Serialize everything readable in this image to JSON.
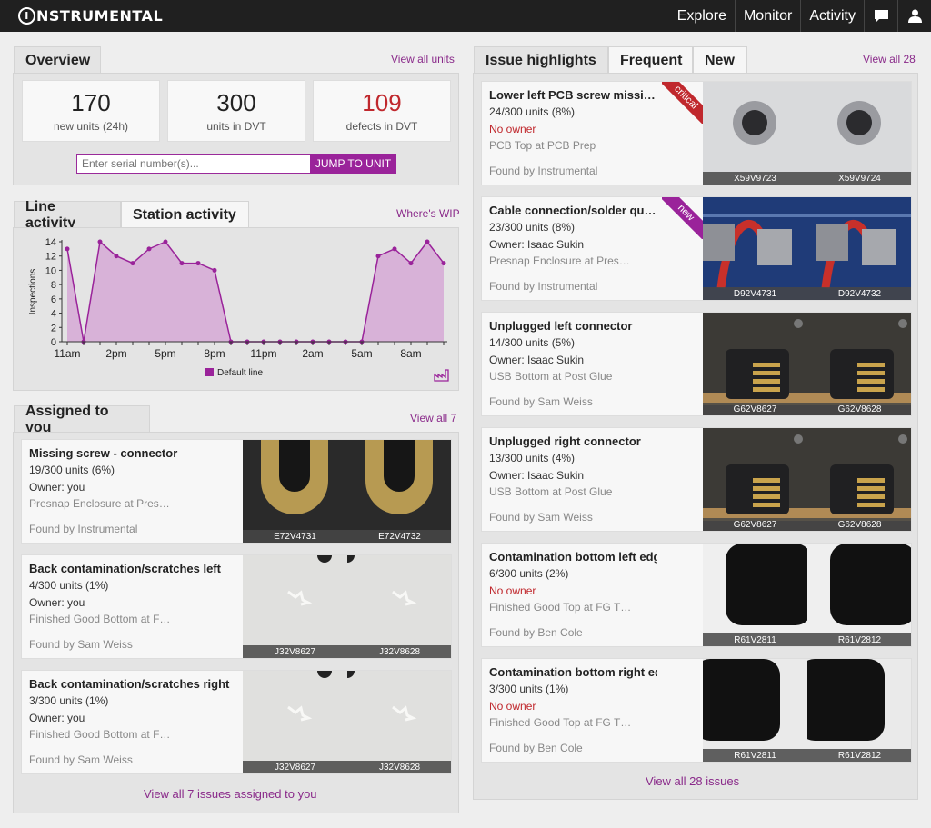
{
  "nav": {
    "logo_text": "NSTRUMENTAL",
    "logo_letter": "I",
    "items": [
      "Explore",
      "Monitor",
      "Activity"
    ],
    "chat_icon": "chat-icon",
    "user_icon": "user-icon"
  },
  "overview": {
    "title": "Overview",
    "link": "View all units",
    "stats": [
      {
        "value": "170",
        "label": "new units (24h)",
        "color": "#222222"
      },
      {
        "value": "300",
        "label": "units in DVT",
        "color": "#222222"
      },
      {
        "value": "109",
        "label": "defects in DVT",
        "color": "#c0282d"
      }
    ],
    "serial_placeholder": "Enter serial number(s)...",
    "jump_label": "JUMP TO UNIT"
  },
  "activity": {
    "tabs": [
      "Line activity",
      "Station activity"
    ],
    "link": "Where's WIP",
    "icon": "factory-icon"
  },
  "chart_data": {
    "type": "area",
    "x": [
      "11am",
      "",
      "",
      "2pm",
      "",
      "",
      "5pm",
      "",
      "",
      "8pm",
      "",
      "",
      "11pm",
      "",
      "",
      "2am",
      "",
      "",
      "5am",
      "",
      "",
      "8am",
      "",
      "",
      ""
    ],
    "xticks": [
      "11am",
      "2pm",
      "5pm",
      "8pm",
      "11pm",
      "2am",
      "5am",
      "8am"
    ],
    "series": [
      {
        "name": "Default line",
        "values": [
          13,
          0,
          14,
          12,
          11,
          13,
          14,
          11,
          11,
          10,
          0,
          0,
          0,
          0,
          0,
          0,
          0,
          0,
          0,
          12,
          13,
          11,
          14,
          11
        ]
      }
    ],
    "ylabel": "Inspections",
    "ylim": [
      0,
      14
    ],
    "yticks": [
      0,
      2,
      4,
      6,
      8,
      10,
      12,
      14
    ],
    "color": "#9a239a"
  },
  "assigned": {
    "title": "Assigned to you",
    "link": "View all 7",
    "bottom_link": "View all 7 issues assigned to you",
    "cards": [
      {
        "title": "Missing screw - connector",
        "units": "19/300 units (6%)",
        "owner": "Owner: you",
        "location": "Presnap Enclosure at Pres…",
        "found": "Found by Instrumental",
        "imgs": [
          "E72V4731",
          "E72V4732"
        ]
      },
      {
        "title": "Back contamination/scratches left",
        "units": "4/300 units (1%)",
        "owner": "Owner: you",
        "location": "Finished Good Bottom at F…",
        "found": "Found by Sam Weiss",
        "imgs": [
          "J32V8627",
          "J32V8628"
        ]
      },
      {
        "title": "Back contamination/scratches right",
        "units": "3/300 units (1%)",
        "owner": "Owner: you",
        "location": "Finished Good Bottom at F…",
        "found": "Found by Sam Weiss",
        "imgs": [
          "J32V8627",
          "J32V8628"
        ]
      }
    ]
  },
  "issues": {
    "tabs": [
      "Issue highlights",
      "Frequent",
      "New"
    ],
    "link": "View all 28",
    "bottom_link": "View all 28 issues",
    "cards": [
      {
        "title": "Lower left PCB screw missi…",
        "units": "24/300 units (8%)",
        "owner": "No owner",
        "location": "PCB Top at PCB Prep",
        "found": "Found by Instrumental",
        "imgs": [
          "X59V9723",
          "X59V9724"
        ],
        "badge": "critical"
      },
      {
        "title": "Cable connection/solder qu…",
        "units": "23/300 units (8%)",
        "owner": "Owner: Isaac Sukin",
        "location": "Presnap Enclosure at Pres…",
        "found": "Found by Instrumental",
        "imgs": [
          "D92V4731",
          "D92V4732"
        ],
        "badge": "new"
      },
      {
        "title": "Unplugged left connector",
        "units": "14/300 units (5%)",
        "owner": "Owner: Isaac Sukin",
        "location": "USB Bottom at Post Glue",
        "found": "Found by Sam Weiss",
        "imgs": [
          "G62V8627",
          "G62V8628"
        ]
      },
      {
        "title": "Unplugged right connector",
        "units": "13/300 units (4%)",
        "owner": "Owner: Isaac Sukin",
        "location": "USB Bottom at Post Glue",
        "found": "Found by Sam Weiss",
        "imgs": [
          "G62V8627",
          "G62V8628"
        ]
      },
      {
        "title": "Contamination bottom left edge",
        "units": "6/300 units (2%)",
        "owner": "No owner",
        "location": "Finished Good Top at FG T…",
        "found": "Found by Ben Cole",
        "imgs": [
          "R61V2811",
          "R61V2812"
        ]
      },
      {
        "title": "Contamination bottom right edge",
        "units": "3/300 units (1%)",
        "owner": "No owner",
        "location": "Finished Good Top at FG T…",
        "found": "Found by Ben Cole",
        "imgs": [
          "R61V2811",
          "R61V2812"
        ]
      }
    ]
  }
}
